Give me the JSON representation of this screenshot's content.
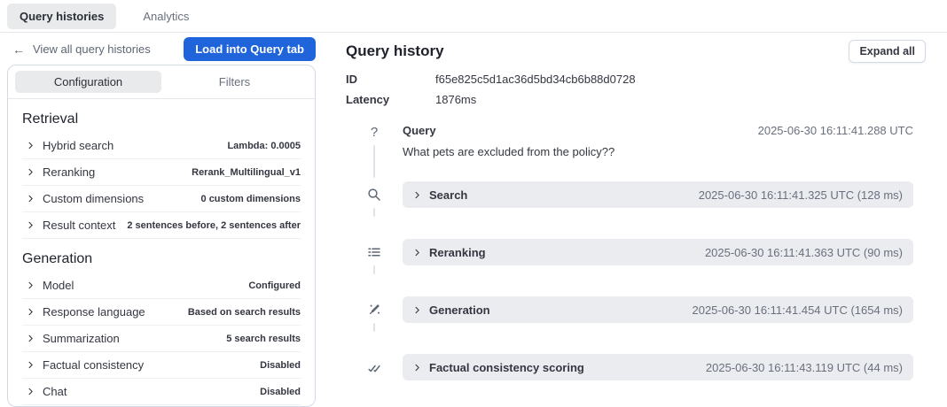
{
  "top_nav": {
    "tabs": [
      {
        "label": "Query histories",
        "active": true
      },
      {
        "label": "Analytics",
        "active": false
      }
    ]
  },
  "left_panel": {
    "back_link": "View all query histories",
    "load_button": "Load into Query tab",
    "tabs": [
      {
        "label": "Configuration",
        "active": true
      },
      {
        "label": "Filters",
        "active": false
      }
    ],
    "sections": [
      {
        "title": "Retrieval",
        "rows": [
          {
            "label": "Hybrid search",
            "value": "Lambda: 0.0005"
          },
          {
            "label": "Reranking",
            "value": "Rerank_Multilingual_v1"
          },
          {
            "label": "Custom dimensions",
            "value": "0 custom dimensions"
          },
          {
            "label": "Result context",
            "value": "2 sentences before, 2 sentences after"
          }
        ]
      },
      {
        "title": "Generation",
        "rows": [
          {
            "label": "Model",
            "value": "Configured"
          },
          {
            "label": "Response language",
            "value": "Based on search results"
          },
          {
            "label": "Summarization",
            "value": "5 search results"
          },
          {
            "label": "Factual consistency",
            "value": "Disabled"
          },
          {
            "label": "Chat",
            "value": "Disabled"
          }
        ]
      }
    ]
  },
  "right_panel": {
    "title": "Query history",
    "expand_all_button": "Expand all",
    "meta": [
      {
        "label": "ID",
        "value": "f65e825c5d1ac36d5bd34cb6b88d0728"
      },
      {
        "label": "Latency",
        "value": "1876ms"
      }
    ],
    "timeline": {
      "query": {
        "label": "Query",
        "timestamp": "2025-06-30 16:11:41.288 UTC",
        "text": "What pets are excluded from the policy??",
        "icon": "question-icon"
      },
      "steps": [
        {
          "label": "Search",
          "timestamp": "2025-06-30 16:11:41.325 UTC (128 ms)",
          "icon": "search-icon"
        },
        {
          "label": "Reranking",
          "timestamp": "2025-06-30 16:11:41.363 UTC (90 ms)",
          "icon": "list-icon"
        },
        {
          "label": "Generation",
          "timestamp": "2025-06-30 16:11:41.454 UTC (1654 ms)",
          "icon": "magic-wand-icon"
        },
        {
          "label": "Factual consistency scoring",
          "timestamp": "2025-06-30 16:11:43.119 UTC (44 ms)",
          "icon": "double-check-icon"
        }
      ]
    }
  },
  "icons": {
    "back_arrow": "←",
    "question_mark": "?"
  },
  "colors": {
    "accent_blue": "#2064DC",
    "text_dark": "#343741",
    "text_subdued": "#69707D",
    "border": "#D3DAE6",
    "pill_fill": "#E9EAEC",
    "accordion_fill": "#EBECF0"
  }
}
